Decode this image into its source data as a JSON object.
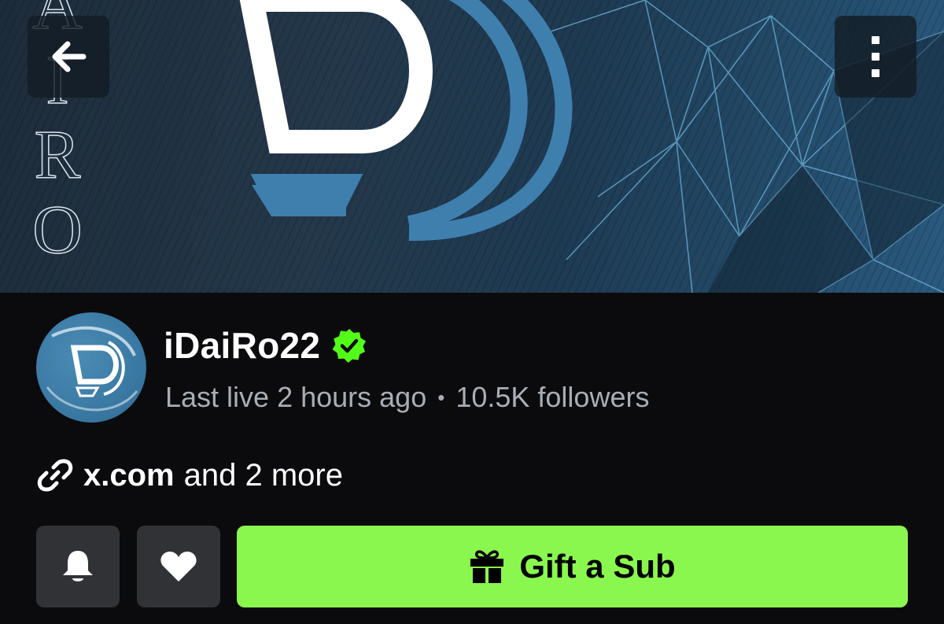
{
  "banner": {
    "vertical_text": [
      "A",
      "I",
      "R",
      "O"
    ],
    "colors": {
      "base": "#24384a",
      "logo_blue": "#3f7fae",
      "logo_white": "#ffffff"
    }
  },
  "header": {
    "back_icon": "arrow-left-icon",
    "more_icon": "kebab-menu-icon"
  },
  "profile": {
    "channel_name": "iDaiRo22",
    "verified_icon": "verified-badge-icon",
    "verified_color": "#53fc18",
    "last_live": "Last live 2 hours ago",
    "separator": "•",
    "followers": "10.5K followers"
  },
  "links": {
    "icon": "link-icon",
    "primary": "x.com",
    "more": "and 2 more"
  },
  "actions": {
    "bell_icon": "bell-icon",
    "heart_icon": "heart-icon",
    "gift_icon": "gift-icon",
    "gift_label": "Gift a Sub",
    "accent_color": "#8af74f"
  }
}
